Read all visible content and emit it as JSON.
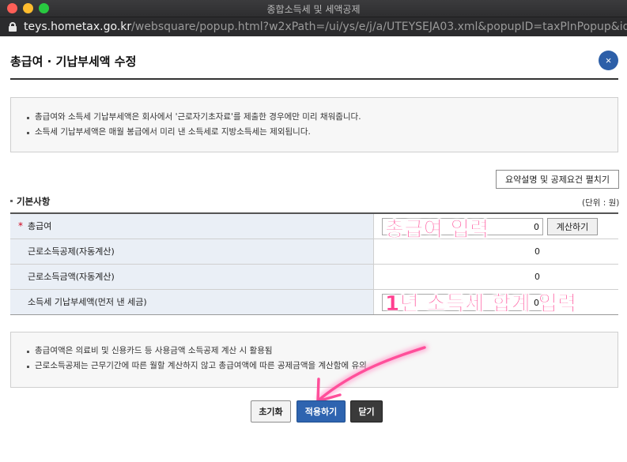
{
  "window": {
    "title": "종합소득세 및 세액공제"
  },
  "url": {
    "host": "teys.hometax.go.kr",
    "path": "/websquare/popup.html?w2xPath=/ui/ys/e/j/a/UTEYSEJA03.xml&popupID=taxPlnPopup&idx..."
  },
  "popup": {
    "title": "총급여 · 기납부세액 수정",
    "close_label": "×"
  },
  "notice_top": [
    "총급여와 소득세 기납부세액은 회사에서 '근로자기초자료'를 제출한 경우에만 미리 채워줍니다.",
    "소득세 기납부세액은 매월 봉급에서 미리 낸 소득세로 지방소득세는 제외됩니다."
  ],
  "expand_button": "요약설명 및 공제요건 펼치기",
  "section": {
    "title": "기본사항",
    "unit": "(단위 : 원)"
  },
  "rows": [
    {
      "label": "총급여",
      "required_mark": "*",
      "value": "0",
      "button": "계산하기"
    },
    {
      "label": "근로소득공제(자동계산)",
      "value": "0"
    },
    {
      "label": "근로소득금액(자동계산)",
      "value": "0"
    },
    {
      "label": "소득세 기납부세액(먼저 낸 세금)",
      "value": "0"
    }
  ],
  "overlay": {
    "label1": "총급여 입력",
    "label2": "1년 소득세 합계 입력",
    "color": "#ff3f8f"
  },
  "notice_bottom": [
    "총급여액은 의료비 및 신용카드 등 사용금액 소득공제 계산 시 활용됨",
    "근로소득공제는 근무기간에 따른 월할 계산하지 않고 총급여액에 따른 공제금액을 계산함에 유의"
  ],
  "buttons": {
    "reset": "초기화",
    "apply": "적용하기",
    "close": "닫기"
  },
  "colors": {
    "accent": "#2e64b0",
    "close_circle": "#2d5fa8",
    "label_bg": "#eaeff6"
  }
}
